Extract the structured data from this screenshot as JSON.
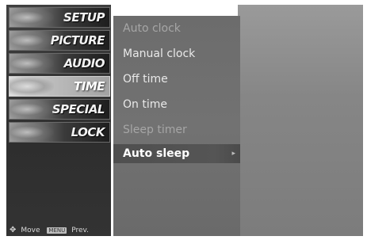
{
  "left_menu": [
    {
      "label": "SETUP",
      "icon": "setup-icon"
    },
    {
      "label": "PICTURE",
      "icon": "picture-icon"
    },
    {
      "label": "AUDIO",
      "icon": "audio-icon"
    },
    {
      "label": "TIME",
      "icon": "time-icon",
      "selected": true
    },
    {
      "label": "SPECIAL",
      "icon": "special-icon"
    },
    {
      "label": "LOCK",
      "icon": "lock-icon"
    }
  ],
  "submenu": [
    {
      "label": "Auto clock",
      "state": "dim"
    },
    {
      "label": "Manual clock",
      "state": "normal"
    },
    {
      "label": "Off time",
      "state": "normal"
    },
    {
      "label": "On time",
      "state": "normal"
    },
    {
      "label": "Sleep timer",
      "state": "dim"
    },
    {
      "label": "Auto sleep",
      "state": "selected",
      "arrow": "▸"
    }
  ],
  "hints": {
    "move_icon": "✥",
    "move_label": "Move",
    "prev_key": "MENU",
    "prev_label": "Prev."
  }
}
